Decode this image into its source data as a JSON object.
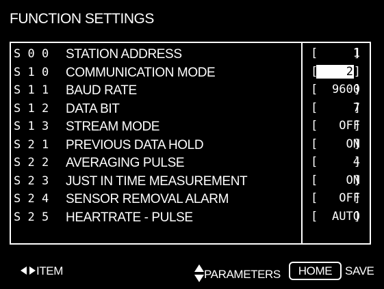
{
  "title": "FUNCTION SETTINGS",
  "rows": [
    {
      "code": "S00",
      "label": "STATION ADDRESS",
      "value": "1",
      "selected": false
    },
    {
      "code": "S10",
      "label": "COMMUNICATION MODE",
      "value": "2",
      "selected": true
    },
    {
      "code": "S11",
      "label": "BAUD RATE",
      "value": "9600",
      "selected": false
    },
    {
      "code": "S12",
      "label": "DATA BIT",
      "value": "7",
      "selected": false
    },
    {
      "code": "S13",
      "label": "STREAM MODE",
      "value": "OFF",
      "selected": false
    },
    {
      "code": "S21",
      "label": "PREVIOUS DATA HOLD",
      "value": "ON",
      "selected": false
    },
    {
      "code": "S22",
      "label": "AVERAGING PULSE",
      "value": "4",
      "selected": false
    },
    {
      "code": "S23",
      "label": "JUST IN TIME MEASUREMENT",
      "value": "ON",
      "selected": false
    },
    {
      "code": "S24",
      "label": "SENSOR REMOVAL ALARM",
      "value": "OFF",
      "selected": false
    },
    {
      "code": "S25",
      "label": "HEARTRATE - PULSE",
      "value": "AUTO",
      "selected": false
    }
  ],
  "footer": {
    "item_label": "ITEM",
    "item_icon": "left-right-arrows-icon",
    "parameters_label": "PARAMETERS",
    "parameters_icon": "up-down-arrows-icon",
    "home_label": "HOME",
    "save_label": "SAVE"
  },
  "colors": {
    "background": "#000000",
    "foreground": "#ffffff",
    "highlight_background": "#ffffff",
    "highlight_text": "#000000"
  }
}
